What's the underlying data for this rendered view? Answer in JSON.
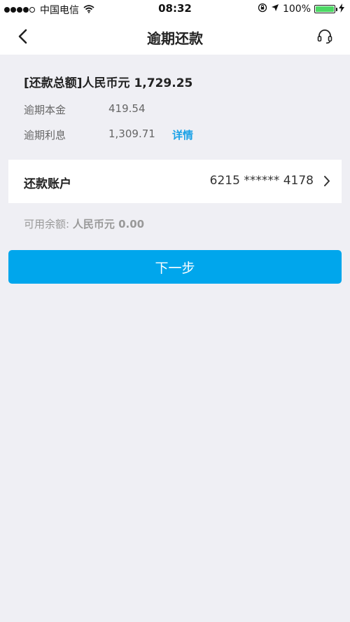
{
  "status_bar": {
    "carrier": "中国电信",
    "time": "08:32",
    "battery": "100%",
    "battery_level": 1.0,
    "icons": [
      "signal-dots",
      "wifi-icon",
      "orientation-lock-icon",
      "location-arrow-icon",
      "battery-icon",
      "charging-icon"
    ]
  },
  "nav": {
    "title": "逾期还款",
    "back_icon": "chevron-left-icon",
    "service_icon": "headset-icon"
  },
  "summary": {
    "total_label": "[还款总额]人民币元 1,729.25",
    "principal_label": "逾期本金",
    "principal_value": "419.54",
    "interest_label": "逾期利息",
    "interest_value": "1,309.71",
    "details_link": "详情"
  },
  "account": {
    "label": "还款账户",
    "number": "6215 ****** 4178",
    "chevron_icon": "chevron-right-icon"
  },
  "balance": {
    "label": "可用余额:",
    "value": "人民币元 0.00"
  },
  "actions": {
    "next_label": "下一步"
  },
  "colors": {
    "accent": "#00a6ec",
    "link": "#1aa1e6",
    "background": "#efeff4",
    "battery": "#4cd964"
  }
}
